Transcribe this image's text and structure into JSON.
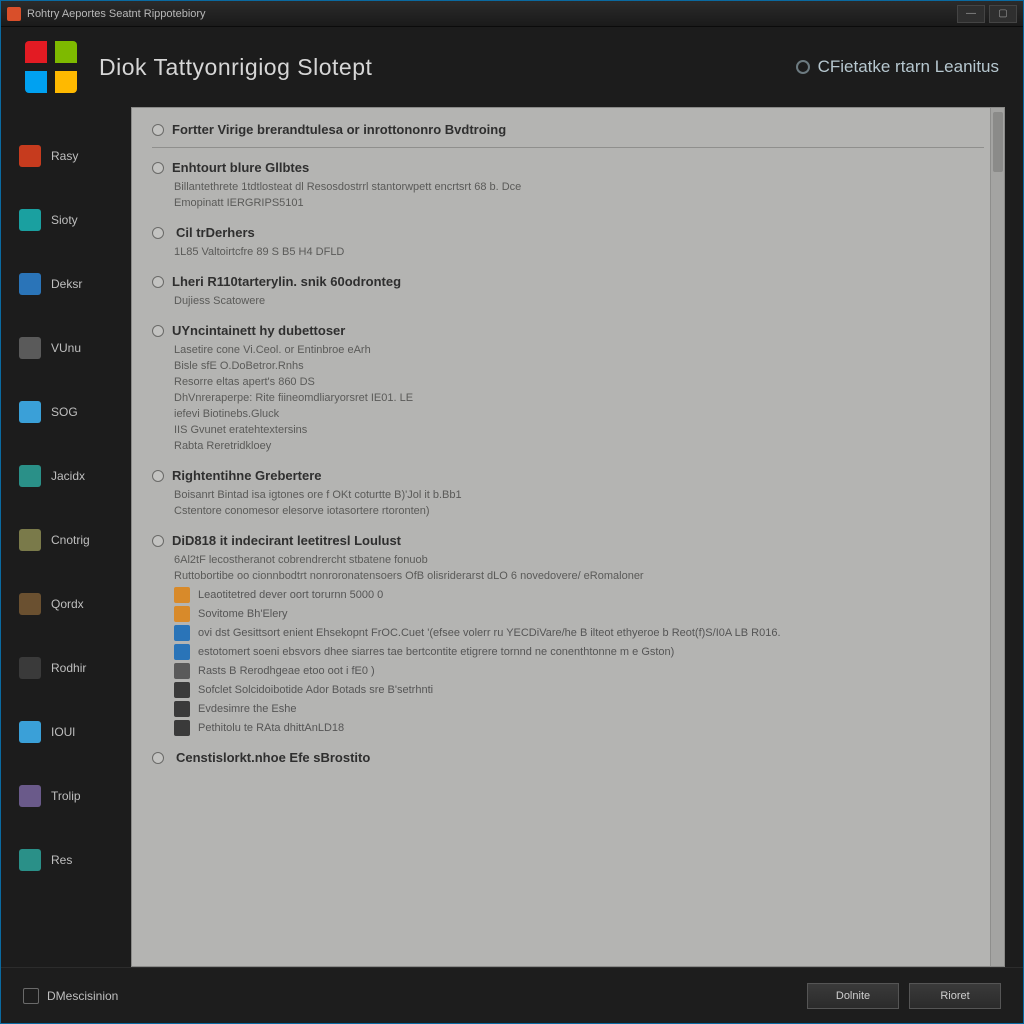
{
  "window": {
    "title": "Rohtry Aeportes Seatnt Rippotebiory"
  },
  "header": {
    "page_title": "Diok Tattyonrigiog Slotept",
    "subtitle": "CFietatke rtarn Leanitus"
  },
  "sidebar": {
    "items": [
      {
        "label": "Rasy",
        "color": "c-red"
      },
      {
        "label": "Sioty",
        "color": "c-cyan"
      },
      {
        "label": "Deksr",
        "color": "c-blue"
      },
      {
        "label": "VUnu",
        "color": "c-grey"
      },
      {
        "label": "SOG",
        "color": "c-sky"
      },
      {
        "label": "Jacidx",
        "color": "c-teal"
      },
      {
        "label": "Cnotrig",
        "color": "c-olive"
      },
      {
        "label": "Qordx",
        "color": "c-brown"
      },
      {
        "label": "Rodhir",
        "color": "c-dark"
      },
      {
        "label": "IOUl",
        "color": "c-sky"
      },
      {
        "label": "Trolip",
        "color": "c-purple"
      },
      {
        "label": "Res",
        "color": "c-teal"
      }
    ]
  },
  "panel": {
    "breadcrumb": "Fortter Virige brerandtulesa or inrottononro Bvdtroing",
    "sections": [
      {
        "title": "Enhtourt blure Gllbtes",
        "lines": [
          "Billantethrete 1tdtlosteat dl Resosdostrrl stantorwpett encrtsrt 68 b. Dce",
          "Emopinatt   IERGRIPS5101"
        ]
      },
      {
        "title": "Cil trDerhers",
        "icon": "c-grey",
        "lines": [
          "1L85 Valtoirtcfre 89 S B5 H4 DFLD"
        ]
      },
      {
        "title": "Lheri R110tarterylin. snik 60odronteg",
        "lines": [
          "Dujiess Scatowere"
        ]
      },
      {
        "title": "UYncintainett hy dubettoser",
        "lines": [
          "Lasetire cone Vi.Ceol. or Entinbroe eArh",
          "Bisle sfE O.DoBetror.Rnhs",
          "Resorre  eltas apert's 860 DS",
          "",
          "DhVnreraperpe: Rite fiineomdliaryorsret IE01. LE",
          "iefevi      Biotinebs.Gluck",
          "IIS    Gvunet eratehtextersins",
          "Rabta  Reretridkloey"
        ]
      },
      {
        "title": "Rightentihne Grebertere",
        "lines": [
          "Boisanrt Bintad isa igtones ore f OKt coturtte B)'Jol it b.Bb1",
          "Cstentore conomesor elesorve iotasortere rtoronten)"
        ]
      },
      {
        "title": "DiD818 it indecirant leetitresl Loulust",
        "lines": [
          "6Al2tF lecostheranot cobrendrercht stbatene fonuob",
          "Ruttobortibe oo cionnbodtrt nonroronatensoers OfB olisriderarst dLO 6 novedovere/ eRomaloner"
        ],
        "items": [
          {
            "icon": "c-orange",
            "text": "Leaotitetred dever oort torurnn 5000 0"
          },
          {
            "icon": "c-orange",
            "text": "Sovitome Bh'Elery"
          },
          {
            "icon": "c-blue",
            "text": "ovi dst Gesittsort enient Ehsekopnt FrOC.Cuet '(efsee volerr ru YECDiVare/he B ilteot ethyeroe b Reot(f)S/I0A LB  R016."
          },
          {
            "icon": "c-blue",
            "text": "estotomert soeni ebsvors dhee siarres tae bertcontite etigrere tornnd ne conenthtonne m e Gston)"
          },
          {
            "icon": "c-grey",
            "text": "Rasts B Rerodhgeae etoo oot i fE0 )"
          },
          {
            "icon": "c-dark",
            "text": "Sofclet Solcidoibotide Ador Botads sre B'setrhnti"
          },
          {
            "icon": "c-dark",
            "text": "Evdesimre the Eshe"
          },
          {
            "icon": "c-dark",
            "text": "Pethitolu te RAta dhittAnLD18"
          }
        ]
      },
      {
        "title": "",
        "icon": "c-teal",
        "standalone": "Censtislorkt.nhoe Efe    sBrostito"
      }
    ]
  },
  "footer": {
    "left_label": "DMescisinion",
    "btn_primary": "Dolnite",
    "btn_secondary": "Rioret"
  }
}
